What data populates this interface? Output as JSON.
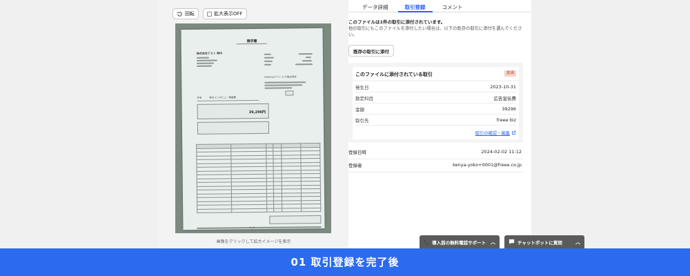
{
  "toolbar": {
    "rotate_label": "回転",
    "zoom_label": "拡大表示OFF"
  },
  "document_photo": {
    "title": "請求書",
    "recipient": "株式会社テスト 御中",
    "issuer": "freee bizフリービズ株式会社",
    "subject_label": "件名",
    "subject": "取引インタビュー掲載費",
    "total": "39,296円",
    "page": "1 / 1"
  },
  "preview_hint": "画像をクリックして拡大イメージを表示",
  "tabs": [
    {
      "label": "データ詳細"
    },
    {
      "label": "取引登録"
    },
    {
      "label": "コメント"
    }
  ],
  "message": {
    "line1": "このファイルは1件の取引に添付されています。",
    "line2": "他の取引にもこのファイルを添付したい場合は、以下の既存の取引に添付を選んでください。"
  },
  "attach_button_label": "既存の取引に添付",
  "card": {
    "title": "このファイルに添付されている取引",
    "badge": "支出",
    "rows": [
      {
        "label": "発生日",
        "value": "2023-10-31"
      },
      {
        "label": "勘定科目",
        "value": "広告宣伝費"
      },
      {
        "label": "金額",
        "value": "39296"
      },
      {
        "label": "取引先",
        "value": "freee biz"
      }
    ],
    "link_label": "取引の確認・編集"
  },
  "other_rows": [
    {
      "label": "登録日時",
      "value": "2024-02-02 11:12"
    },
    {
      "label": "登録者",
      "value": "kenya-yoko+0001@freee.co.jp"
    }
  ],
  "widgets": {
    "support_label": "導入前の無料電話サポート",
    "chatbot_label": "チャットボットに質問"
  },
  "banner": "01 取引登録を完了後",
  "colors": {
    "accent": "#2864f0",
    "banner": "#2c6af0",
    "badge_bg": "#f7d1c9",
    "badge_text": "#b03a20",
    "widget_bg": "#5b5b5b"
  }
}
